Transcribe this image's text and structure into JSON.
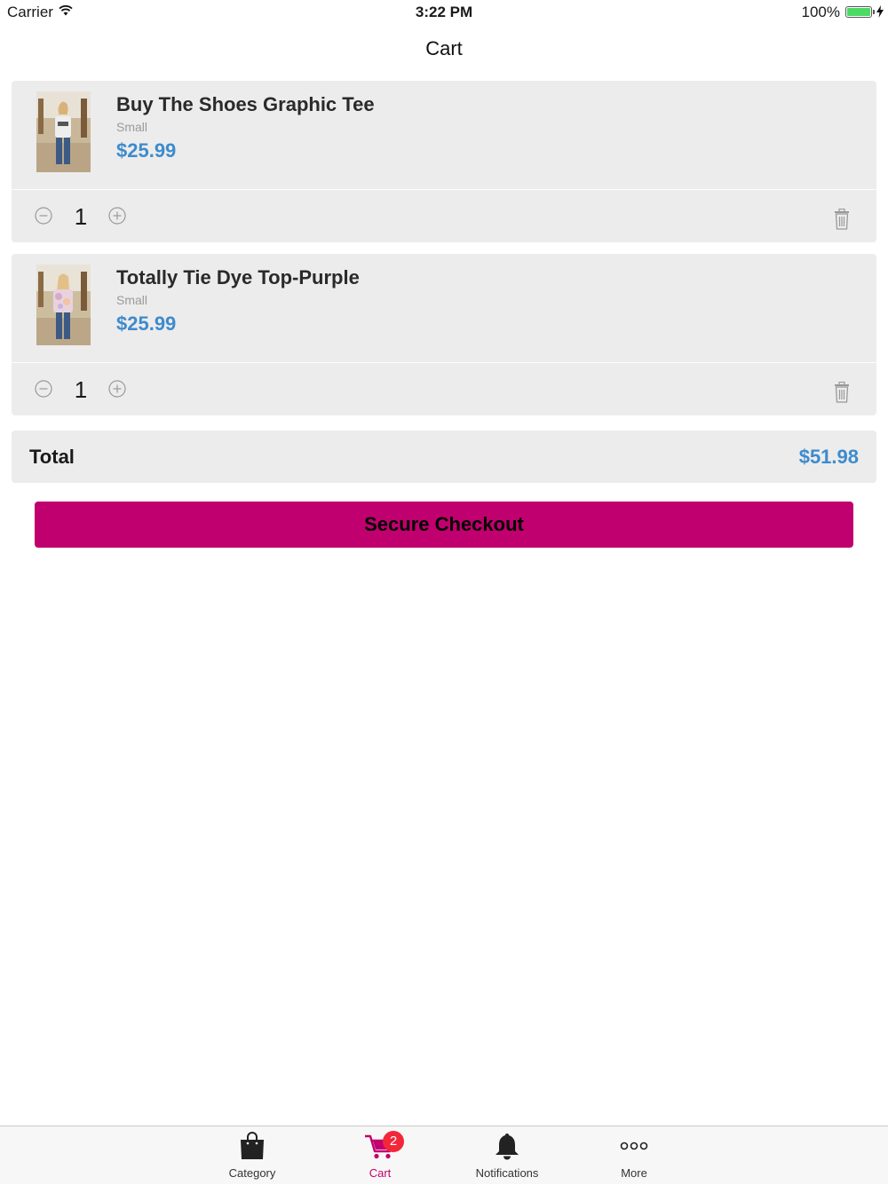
{
  "status_bar": {
    "carrier": "Carrier",
    "time": "3:22 PM",
    "battery": "100%",
    "battery_color": "#4cd964"
  },
  "nav": {
    "title": "Cart"
  },
  "cart": {
    "items": [
      {
        "title": "Buy The Shoes Graphic Tee",
        "variant": "Small",
        "price": "$25.99",
        "quantity": "1"
      },
      {
        "title": "Totally Tie Dye Top-Purple",
        "variant": "Small",
        "price": "$25.99",
        "quantity": "1"
      }
    ]
  },
  "total": {
    "label": "Total",
    "value": "$51.98"
  },
  "checkout": {
    "label": "Secure Checkout",
    "color": "#c1006f"
  },
  "tab_bar": {
    "active_color": "#c1006f",
    "tabs": [
      {
        "label": "Category",
        "icon": "shopping-bag-icon"
      },
      {
        "label": "Cart",
        "icon": "cart-icon",
        "badge": "2"
      },
      {
        "label": "Notifications",
        "icon": "bell-icon"
      },
      {
        "label": "More",
        "icon": "more-dots-icon"
      }
    ]
  },
  "colors": {
    "price": "#3d8bcd",
    "card_bg": "#ececec"
  }
}
